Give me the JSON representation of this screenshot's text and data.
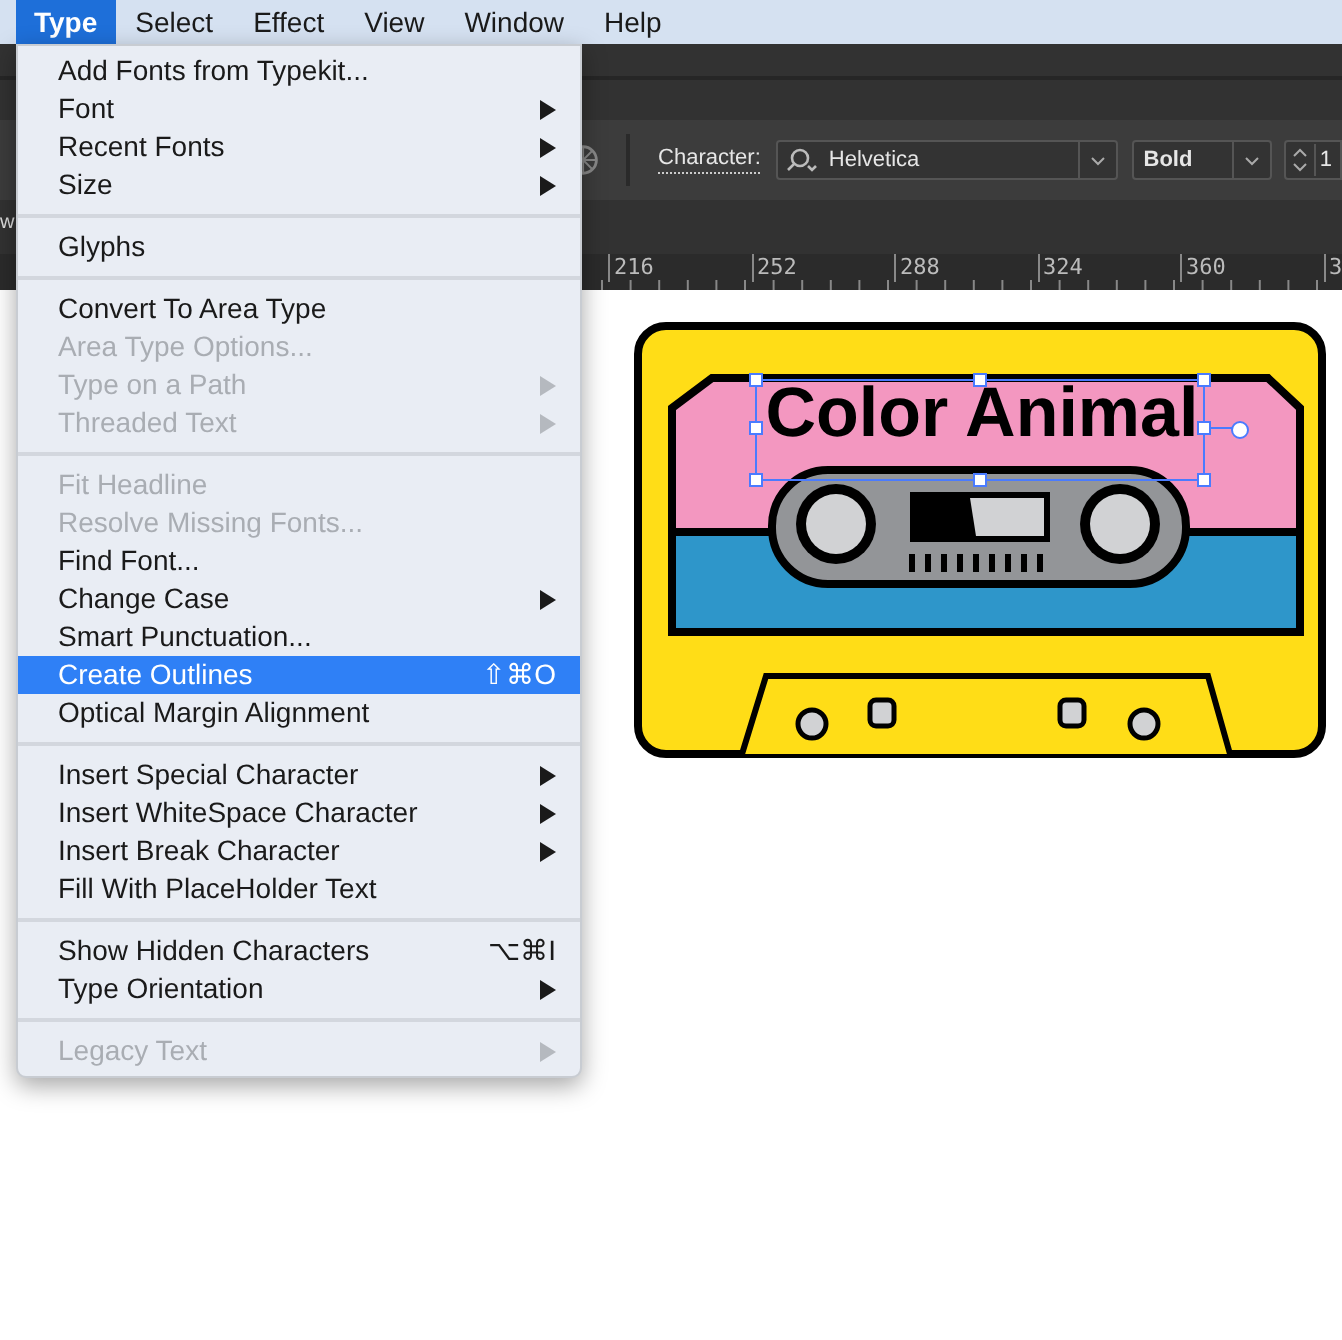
{
  "menubar": [
    {
      "label": "Type",
      "selected": true
    },
    {
      "label": "Select",
      "selected": false
    },
    {
      "label": "Effect",
      "selected": false
    },
    {
      "label": "View",
      "selected": false
    },
    {
      "label": "Window",
      "selected": false
    },
    {
      "label": "Help",
      "selected": false
    }
  ],
  "edge_text": "w",
  "control_bar": {
    "label": "Character:",
    "font_field": "Helvetica",
    "style_field": "Bold",
    "size_field": "1"
  },
  "ruler": [
    "216",
    "252",
    "288",
    "324",
    "360",
    "3"
  ],
  "menu": [
    {
      "kind": "item",
      "label": "Add Fonts from Typekit...",
      "disabled": false,
      "submenu": false,
      "selected": false
    },
    {
      "kind": "item",
      "label": "Font",
      "disabled": false,
      "submenu": true,
      "selected": false
    },
    {
      "kind": "item",
      "label": "Recent Fonts",
      "disabled": false,
      "submenu": true,
      "selected": false
    },
    {
      "kind": "item",
      "label": "Size",
      "disabled": false,
      "submenu": true,
      "selected": false
    },
    {
      "kind": "separator"
    },
    {
      "kind": "item",
      "label": "Glyphs",
      "disabled": false,
      "submenu": false,
      "selected": false
    },
    {
      "kind": "separator"
    },
    {
      "kind": "item",
      "label": "Convert To Area Type",
      "disabled": false,
      "submenu": false,
      "selected": false
    },
    {
      "kind": "item",
      "label": "Area Type Options...",
      "disabled": true,
      "submenu": false,
      "selected": false
    },
    {
      "kind": "item",
      "label": "Type on a Path",
      "disabled": true,
      "submenu": true,
      "selected": false
    },
    {
      "kind": "item",
      "label": "Threaded Text",
      "disabled": true,
      "submenu": true,
      "selected": false
    },
    {
      "kind": "separator"
    },
    {
      "kind": "item",
      "label": "Fit Headline",
      "disabled": true,
      "submenu": false,
      "selected": false
    },
    {
      "kind": "item",
      "label": "Resolve Missing Fonts...",
      "disabled": true,
      "submenu": false,
      "selected": false
    },
    {
      "kind": "item",
      "label": "Find Font...",
      "disabled": false,
      "submenu": false,
      "selected": false
    },
    {
      "kind": "item",
      "label": "Change Case",
      "disabled": false,
      "submenu": true,
      "selected": false
    },
    {
      "kind": "item",
      "label": "Smart Punctuation...",
      "disabled": false,
      "submenu": false,
      "selected": false
    },
    {
      "kind": "item",
      "label": "Create Outlines",
      "disabled": false,
      "submenu": false,
      "selected": true,
      "shortcut": "⇧⌘O"
    },
    {
      "kind": "item",
      "label": "Optical Margin Alignment",
      "disabled": false,
      "submenu": false,
      "selected": false
    },
    {
      "kind": "separator"
    },
    {
      "kind": "item",
      "label": "Insert Special Character",
      "disabled": false,
      "submenu": true,
      "selected": false
    },
    {
      "kind": "item",
      "label": "Insert WhiteSpace Character",
      "disabled": false,
      "submenu": true,
      "selected": false
    },
    {
      "kind": "item",
      "label": "Insert Break Character",
      "disabled": false,
      "submenu": true,
      "selected": false
    },
    {
      "kind": "item",
      "label": "Fill With PlaceHolder Text",
      "disabled": false,
      "submenu": false,
      "selected": false
    },
    {
      "kind": "separator"
    },
    {
      "kind": "item",
      "label": "Show Hidden Characters",
      "disabled": false,
      "submenu": false,
      "selected": false,
      "shortcut": "⌥⌘I"
    },
    {
      "kind": "item",
      "label": "Type Orientation",
      "disabled": false,
      "submenu": true,
      "selected": false
    },
    {
      "kind": "separator"
    },
    {
      "kind": "item",
      "label": "Legacy Text",
      "disabled": true,
      "submenu": true,
      "selected": false
    }
  ],
  "artboard": {
    "text": "Color Animal"
  }
}
